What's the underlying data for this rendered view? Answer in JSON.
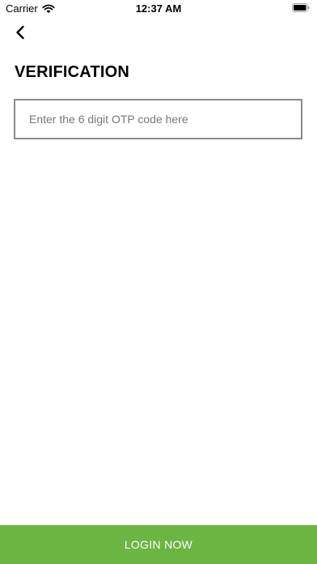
{
  "status_bar": {
    "carrier": "Carrier",
    "time": "12:37 AM"
  },
  "header": {
    "back_icon": "chevron-left-icon",
    "title": "VERIFICATION"
  },
  "otp": {
    "value": "",
    "placeholder": "Enter the 6 digit OTP code here"
  },
  "footer": {
    "login_label": "LOGIN NOW"
  },
  "colors": {
    "accent": "#6bb543",
    "input_border": "#8a8a8a"
  }
}
